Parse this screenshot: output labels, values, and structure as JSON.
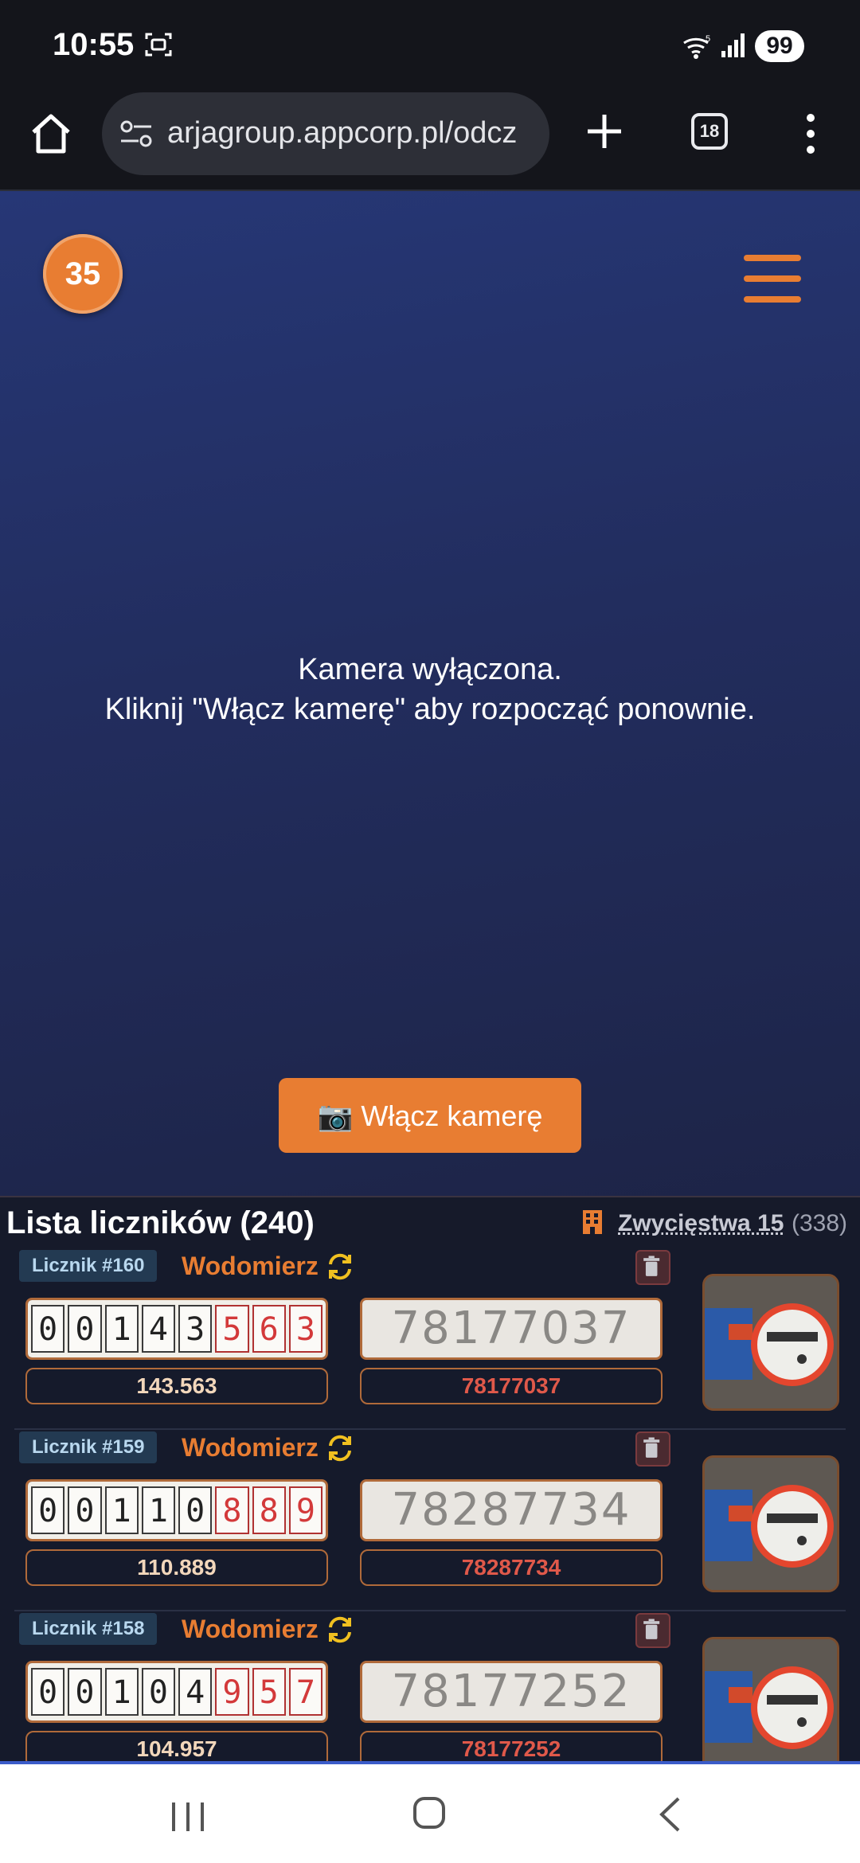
{
  "status_bar": {
    "time": "10:55",
    "battery": "99",
    "icons": [
      "screen-record-icon",
      "wifi-icon",
      "signal-icon"
    ]
  },
  "browser": {
    "url": "arjagroup.appcorp.pl/odcz",
    "tab_count": "18",
    "icons": [
      "home-icon",
      "site-settings-icon",
      "new-tab-icon",
      "menu-dots-icon"
    ]
  },
  "camera": {
    "badge_count": "35",
    "message_line1": "Kamera wyłączona.",
    "message_line2": "Kliknij \"Włącz kamerę\" aby rozpocząć ponownie.",
    "button_label": "📷 Włącz kamerę"
  },
  "list": {
    "title": "Lista liczników (240)",
    "building_name": "Zwycięstwa 15",
    "building_count": "(338)",
    "rows": [
      {
        "tag": "Licznik #160",
        "type": "Wodomierz",
        "reading_digits": [
          "0",
          "0",
          "1",
          "4",
          "3",
          "5",
          "6",
          "3"
        ],
        "reading": "143.563",
        "serial": "78177037"
      },
      {
        "tag": "Licznik #159",
        "type": "Wodomierz",
        "reading_digits": [
          "0",
          "0",
          "1",
          "1",
          "0",
          "8",
          "8",
          "9"
        ],
        "reading": "110.889",
        "serial": "78287734"
      },
      {
        "tag": "Licznik #158",
        "type": "Wodomierz",
        "reading_digits": [
          "0",
          "0",
          "1",
          "0",
          "4",
          "9",
          "5",
          "7"
        ],
        "reading": "104.957",
        "serial": "78177252"
      }
    ]
  },
  "colors": {
    "accent": "#e87d32",
    "serial_red": "#e0594a",
    "camera_bg": "#243270"
  }
}
